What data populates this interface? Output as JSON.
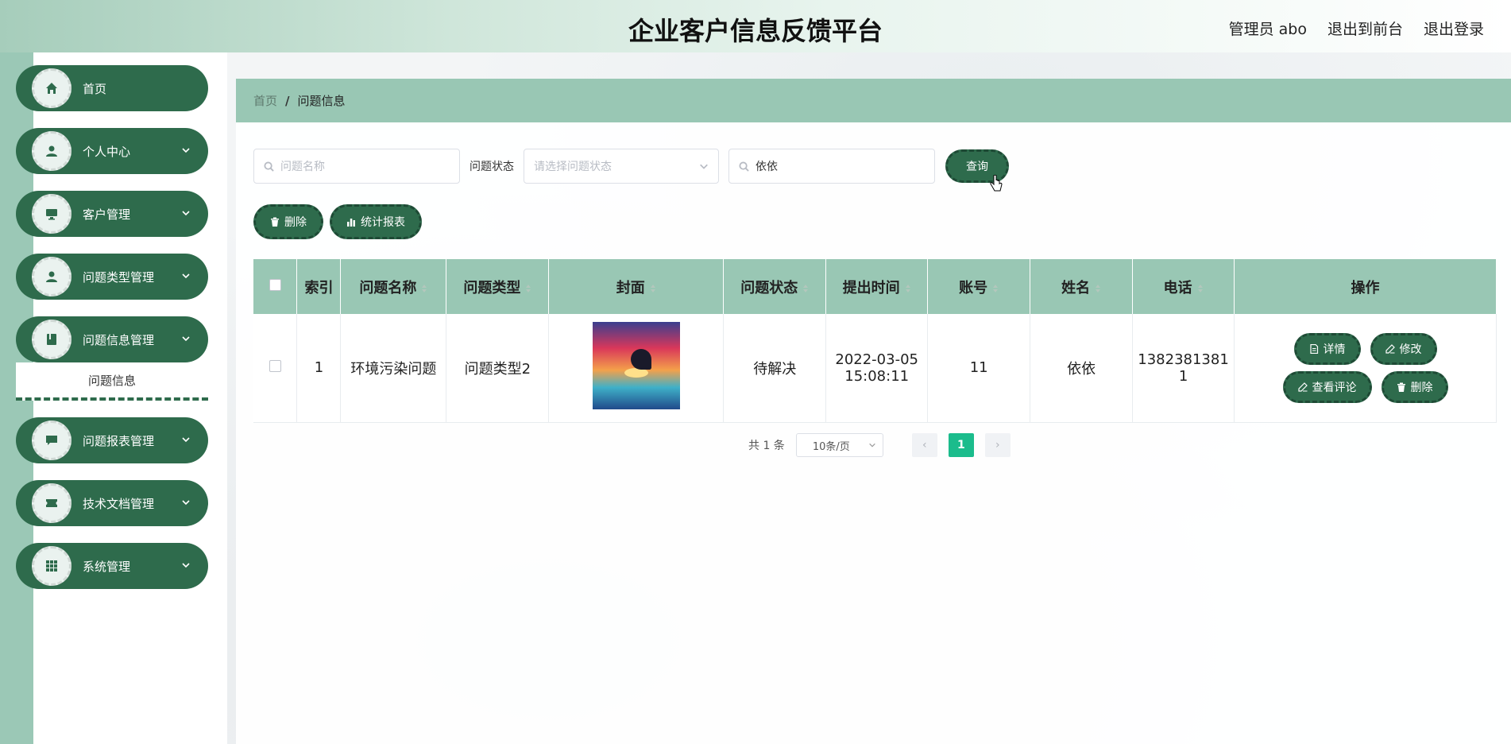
{
  "header": {
    "title": "企业客户信息反馈平台",
    "user": "管理员 abo",
    "front_link": "退出到前台",
    "logout_link": "退出登录"
  },
  "sidebar": {
    "items": [
      {
        "label": "首页",
        "icon": "home-icon"
      },
      {
        "label": "个人中心",
        "icon": "user-icon"
      },
      {
        "label": "客户管理",
        "icon": "monitor-icon"
      },
      {
        "label": "问题类型管理",
        "icon": "user-icon"
      },
      {
        "label": "问题信息管理",
        "icon": "book-icon"
      },
      {
        "label": "问题报表管理",
        "icon": "chat-icon"
      },
      {
        "label": "技术文档管理",
        "icon": "ticket-icon"
      },
      {
        "label": "系统管理",
        "icon": "grid-icon"
      }
    ],
    "submenu_label": "问题信息"
  },
  "breadcrumb": {
    "home": "首页",
    "sep": "/",
    "current": "问题信息"
  },
  "search": {
    "name_placeholder": "问题名称",
    "status_label": "问题状态",
    "status_placeholder": "请选择问题状态",
    "name_value": "依依",
    "query_label": "查询"
  },
  "actions": {
    "delete_label": "删除",
    "report_label": "统计报表"
  },
  "table": {
    "headers": [
      "索引",
      "问题名称",
      "问题类型",
      "封面",
      "问题状态",
      "提出时间",
      "账号",
      "姓名",
      "电话",
      "操作"
    ],
    "rows": [
      {
        "index": "1",
        "name": "环境污染问题",
        "type": "问题类型2",
        "status": "待解决",
        "time_date": "2022-03-05",
        "time_clock": "15:08:11",
        "account": "11",
        "person": "依依",
        "phone_1": "1382381381",
        "phone_2": "1",
        "ops": {
          "detail": "详情",
          "edit": "修改",
          "comments": "查看评论",
          "delete": "删除"
        }
      }
    ]
  },
  "pagination": {
    "total": "共 1 条",
    "page_size": "10条/页",
    "current": "1",
    "prev": "‹",
    "next": "›"
  },
  "colors": {
    "primary": "#2e6b4c",
    "header_bg": "#99c7b4",
    "accent": "#1bbc8c"
  }
}
